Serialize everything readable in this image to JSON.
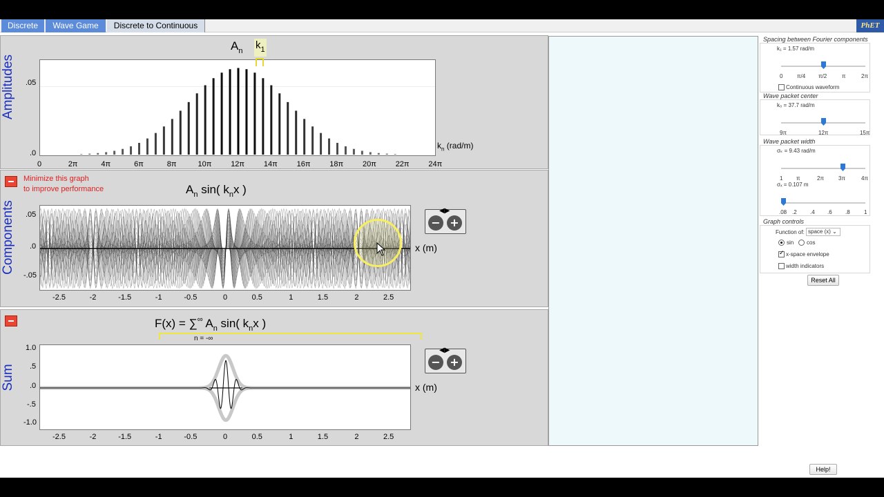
{
  "tabs": [
    {
      "label": "Discrete",
      "active": false
    },
    {
      "label": "Wave Game",
      "active": false
    },
    {
      "label": "Discrete to Continuous",
      "active": true
    }
  ],
  "logo": "PhET",
  "amplitudes_panel": {
    "ylabel": "Amplitudes",
    "title_A": "A",
    "title_n": "n",
    "k1_marker": "k",
    "k1_sub": "1",
    "yticks": [
      ".05",
      ".0"
    ],
    "xticks": [
      "0",
      "2π",
      "4π",
      "6π",
      "8π",
      "10π",
      "12π",
      "14π",
      "16π",
      "18π",
      "20π",
      "22π",
      "24π"
    ],
    "xlabel": "k",
    "xlabel_sub": "n",
    "xlabel_unit": "(rad/m)"
  },
  "components_panel": {
    "ylabel": "Components",
    "minimize_note_line1": "Minimize this graph",
    "minimize_note_line2": "to improve performance",
    "eq": {
      "A": "A",
      "n": "n",
      "sin": "sin( k",
      "n2": "n",
      "x": "x )"
    },
    "yticks": [
      ".05",
      ".0",
      "-.05"
    ],
    "xticks": [
      "-2.5",
      "-2",
      "-1.5",
      "-1",
      "-0.5",
      "0",
      "0.5",
      "1",
      "1.5",
      "2",
      "2.5"
    ],
    "xlabel": "x (m)"
  },
  "sum_panel": {
    "ylabel": "Sum",
    "eq": {
      "F": "F(x) = ∑",
      "inf": "∞",
      "A": "A",
      "n": "n",
      "sin": "sin( k",
      "n2": "n",
      "x": "x )",
      "lower": "n = -∞"
    },
    "yticks": [
      "1.0",
      ".5",
      ".0",
      "-.5",
      "-1.0"
    ],
    "xticks": [
      "-2.5",
      "-2",
      "-1.5",
      "-1",
      "-0.5",
      "0",
      "0.5",
      "1",
      "1.5",
      "2",
      "2.5"
    ],
    "xlabel": "x (m)"
  },
  "controls": {
    "spacing_title": "Spacing between Fourier components",
    "k1_value": "k₁ = 1.57 rad/m",
    "k1_ticks": [
      "0",
      "π/4",
      "π/2",
      "π",
      "2π"
    ],
    "continuous_label": "Continuous waveform",
    "continuous_checked": false,
    "center_title": "Wave packet center",
    "k0_value": "k₀ = 37.7 rad/m",
    "k0_ticks": [
      "9π",
      "12π",
      "15π"
    ],
    "width_title": "Wave packet width",
    "sigmak_value": "σₖ = 9.43 rad/m",
    "sigmak_ticks": [
      "1",
      "π",
      "2π",
      "3π",
      "4π"
    ],
    "sigmax_value": "σₓ = 0.107 m",
    "sigmax_ticks": [
      ".08",
      ".2",
      ".4",
      ".6",
      ".8",
      "1"
    ],
    "graph_title": "Graph controls",
    "function_of_label": "Function of:",
    "function_of_value": "space (x)",
    "sin_label": "sin",
    "cos_label": "cos",
    "envelope_label": "x-space envelope",
    "envelope_checked": true,
    "width_ind_label": "width indicators",
    "width_ind_checked": false,
    "reset_label": "Reset All",
    "help_label": "Help!"
  },
  "chart_data": [
    {
      "type": "bar",
      "title": "A_n",
      "ylabel": "Amplitudes",
      "xlabel": "k_n (rad/m)",
      "k_spacing": 1.5708,
      "k0": 37.7,
      "sigma_k": 9.43,
      "ylim": [
        0,
        0.068
      ],
      "xlim": [
        0,
        75.4
      ],
      "peak_value": 0.0637
    },
    {
      "type": "line",
      "title": "A_n sin(k_n x)",
      "ylabel": "Components",
      "xlabel": "x (m)",
      "xlim": [
        -2.8,
        2.8
      ],
      "ylim": [
        -0.068,
        0.068
      ]
    },
    {
      "type": "line",
      "title": "F(x)",
      "ylabel": "Sum",
      "xlabel": "x (m)",
      "xlim": [
        -2.8,
        2.8
      ],
      "ylim": [
        -1.2,
        1.2
      ],
      "envelope_sigma_x": 0.107
    }
  ]
}
